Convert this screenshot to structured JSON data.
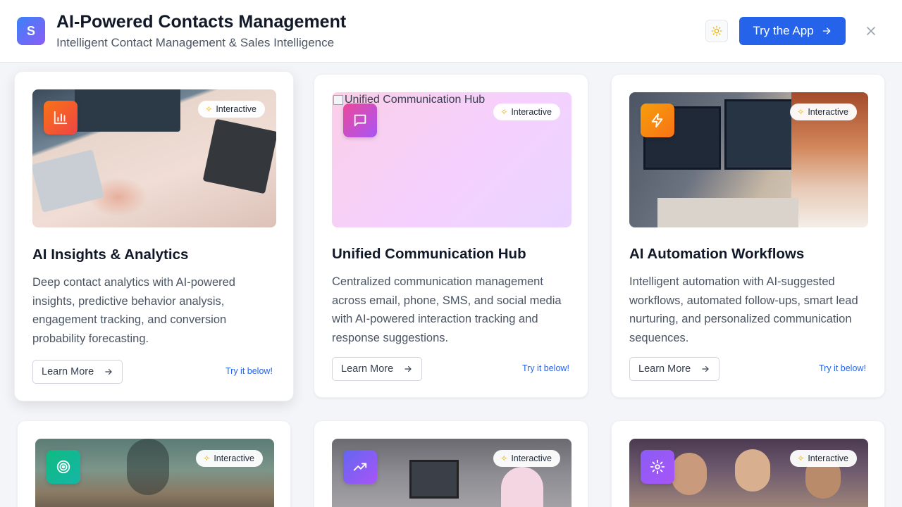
{
  "header": {
    "logo_letter": "S",
    "title": "AI-Powered Contacts Management",
    "subtitle": "Intelligent Contact Management & Sales Intelligence",
    "try_app_label": "Try the App",
    "theme_icon": "sun-icon",
    "close_icon": "close-icon"
  },
  "colors": {
    "primary": "#2563eb",
    "link": "#2563eb",
    "badge_sparkle": "#eab308"
  },
  "cards": [
    {
      "title": "AI Insights & Analytics",
      "description": "Deep contact analytics with AI-powered insights, predictive behavior analysis, engagement tracking, and conversion probability forecasting.",
      "badge": "Interactive",
      "learn_more": "Learn More",
      "try_below": "Try it below!",
      "icon": "bar-chart-icon",
      "icon_gradient": [
        "#f97316",
        "#ef4444"
      ]
    },
    {
      "title": "Unified Communication Hub",
      "image_alt": "Unified Communication Hub",
      "description": "Centralized communication management across email, phone, SMS, and social media with AI-powered interaction tracking and response suggestions.",
      "badge": "Interactive",
      "learn_more": "Learn More",
      "try_below": "Try it below!",
      "icon": "message-square-icon",
      "icon_gradient": [
        "#ec4899",
        "#a855f7"
      ]
    },
    {
      "title": "AI Automation Workflows",
      "description": "Intelligent automation with AI-suggested workflows, automated follow-ups, smart lead nurturing, and personalized communication sequences.",
      "badge": "Interactive",
      "learn_more": "Learn More",
      "try_below": "Try it below!",
      "icon": "lightning-icon",
      "icon_gradient": [
        "#f59e0b",
        "#f97316"
      ]
    },
    {
      "badge": "Interactive",
      "icon": "target-icon",
      "icon_gradient": [
        "#10b981",
        "#14b8a6"
      ]
    },
    {
      "badge": "Interactive",
      "icon": "trending-up-icon",
      "icon_gradient": [
        "#6366f1",
        "#a855f7"
      ]
    },
    {
      "badge": "Interactive",
      "icon": "gear-icon",
      "icon_gradient": [
        "#8b5cf6",
        "#a855f7"
      ]
    }
  ]
}
